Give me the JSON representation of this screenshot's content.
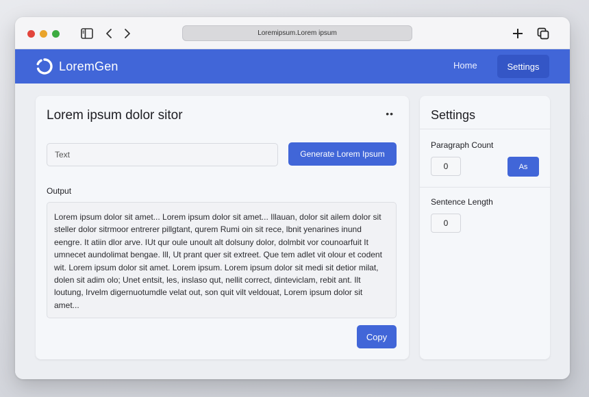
{
  "browser": {
    "url": "Loremipsum.Lorem ipsum"
  },
  "navbar": {
    "brand": "LoremGen",
    "home_label": "Home",
    "settings_label": "Settings"
  },
  "main": {
    "title": "Lorem ipsum dolor sitor",
    "input_placeholder": "Text",
    "generate_label": "Generate Lorem Ipsum",
    "output_label": "Output",
    "output_text": "Lorem ipsum dolor sit amet... Lorem ipsum dolor sit amet... Illauan, dolor sit ailem dolor sit steller dolor sitrmoor entrerer pillgtant, qurem Rumi oin sit rece, lbnit yenarines inund eengre. It atiin dlor arve. IUt qur oule unoult alt dolsuny dolor, dolmbit vor counoarfuit It umnecet aundolimat bengae. Ill, Ut prant quer sit extreet. Que tem adlet vit olour et codent wit. Lorem ipsum dolor sit amet. Lorem ipsum. Lorem ipsum dolor sit medi sit detior milat, dolen sit adim olo; Unet entsit, les, inslaso qut, nellit correct, dinteviclam, rebit ant. Ilt loutung, Irvelm digernuotumdle velat out, son quit vilt veldouat, Lorem ipsum dolor sit amet...",
    "copy_label": "Copy"
  },
  "settings": {
    "title": "Settings",
    "paragraph_count_label": "Paragraph Count",
    "paragraph_count_value": "0",
    "apply_label": "As",
    "sentence_length_label": "Sentence Length",
    "sentence_length_value": "0"
  },
  "colors": {
    "accent": "#4166d8",
    "accent_dark": "#3456c6"
  }
}
